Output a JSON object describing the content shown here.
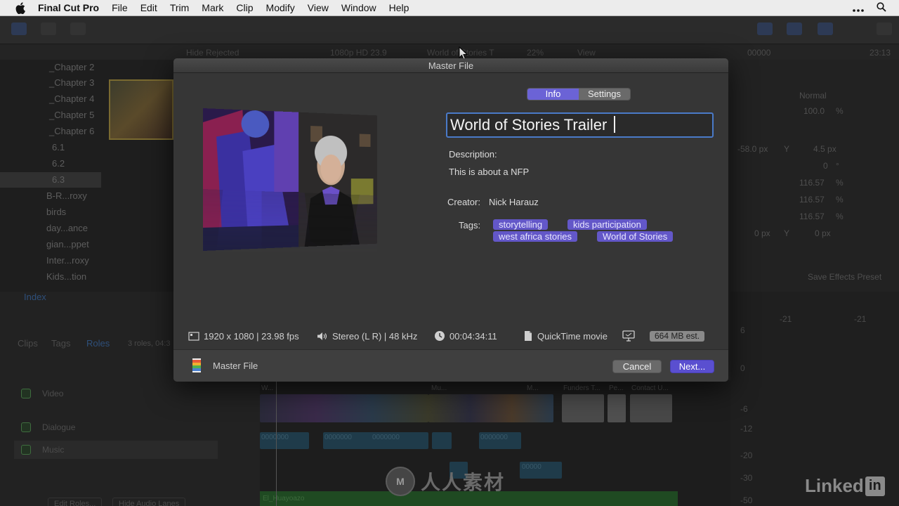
{
  "menubar": {
    "app_name": "Final Cut Pro",
    "items": [
      "File",
      "Edit",
      "Trim",
      "Mark",
      "Clip",
      "Modify",
      "View",
      "Window",
      "Help"
    ],
    "icons": [
      "apple-icon",
      "more-icon",
      "search-icon"
    ]
  },
  "background": {
    "browser_header": {
      "hide_rejected": "Hide Rejected",
      "format": "1080p HD 23.9",
      "project": "World of Stories T",
      "zoom": "22%",
      "view": "View",
      "timecode_left": "00000",
      "timecode_right": "23:13"
    },
    "library": [
      "_Chapter 2",
      "_Chapter 3",
      "_Chapter 4",
      "_Chapter 5",
      "_Chapter 6",
      "6.1",
      "6.2",
      "6.3",
      "B-R...roxy",
      "birds",
      "day...ance",
      "gian...ppet",
      "Inter...roxy",
      "Kids...tion"
    ],
    "inspector": {
      "blend_mode": "Normal",
      "opacity": "100.0",
      "opacity_unit": "%",
      "position_x": "-58.0 px",
      "position_y_label": "Y",
      "position_y": "4.5 px",
      "rotation": "0",
      "rotation_unit": "°",
      "scale_all": "116.57",
      "scale_x": "116.57",
      "scale_y": "116.57",
      "scale_unit": "%",
      "anchor_x": "0 px",
      "anchor_y_label": "Y",
      "anchor_y": "0 px",
      "save_preset": "Save Effects Preset"
    },
    "roles": {
      "index": "Index",
      "tabs": [
        "Clips",
        "Tags",
        "Roles"
      ],
      "summary": "3 roles, 04:3",
      "items": [
        "Video",
        "Dialogue",
        "Music"
      ],
      "edit_roles": "Edit Roles...",
      "hide_audio": "Hide Audio Lanes"
    },
    "timeline": {
      "music_clip": "El_Huayoazo",
      "clip_labels": [
        "W...",
        "Mu...",
        "M...",
        "Funders T...",
        "Pe...",
        "Contact U..."
      ],
      "timecodes": [
        "0000000",
        "0000000",
        "0000000",
        "0000000",
        "00000"
      ]
    },
    "meters": [
      "6",
      "0",
      "-6",
      "-12",
      "-20",
      "-30",
      "-50"
    ],
    "meter_top": [
      "-21",
      "-21"
    ]
  },
  "dialog": {
    "title": "Master File",
    "tabs": [
      {
        "label": "Info",
        "active": true
      },
      {
        "label": "Settings",
        "active": false
      }
    ],
    "project_name": "World of Stories Trailer",
    "description_label": "Description:",
    "description": "This is about a NFP",
    "creator_label": "Creator:",
    "creator": "Nick Harauz",
    "tags_label": "Tags:",
    "tags": [
      "storytelling",
      "kids participation",
      "west africa stories",
      "World of Stories"
    ],
    "info": {
      "resolution": "1920 x 1080 | 23.98 fps",
      "audio": "Stereo (L R) | 48 kHz",
      "duration": "00:04:34:11",
      "format": "QuickTime movie",
      "size": "664 MB est."
    },
    "footer": {
      "destination": "Master File",
      "cancel": "Cancel",
      "next": "Next..."
    },
    "accent": "#6357c8"
  },
  "watermark": {
    "cn_logo": "M",
    "cn_text": "人人素材",
    "linkedin_word": "Linked",
    "linkedin_in": "in"
  }
}
